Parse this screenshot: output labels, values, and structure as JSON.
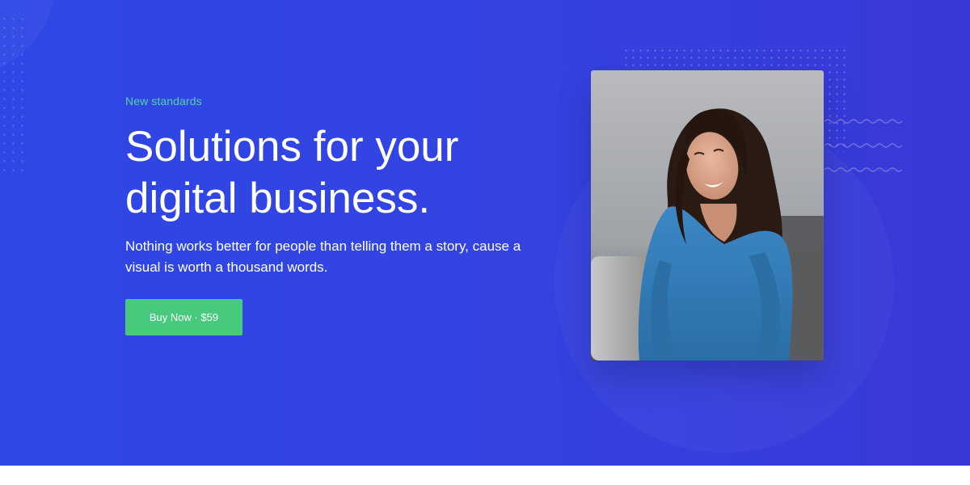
{
  "hero": {
    "eyebrow": "New standards",
    "headline_line1": "Solutions for your",
    "headline_line2": "digital business.",
    "description": "Nothing works better for people than telling them a story, cause a visual is worth a thousand words.",
    "cta_label": "Buy Now · $59"
  },
  "image": {
    "subject": "smiling woman in blue sweater"
  },
  "colors": {
    "background_start": "#2e48e6",
    "background_end": "#3a38d6",
    "accent_text": "#55d3a6",
    "cta_background": "#47c97e",
    "text": "#ffffff"
  }
}
